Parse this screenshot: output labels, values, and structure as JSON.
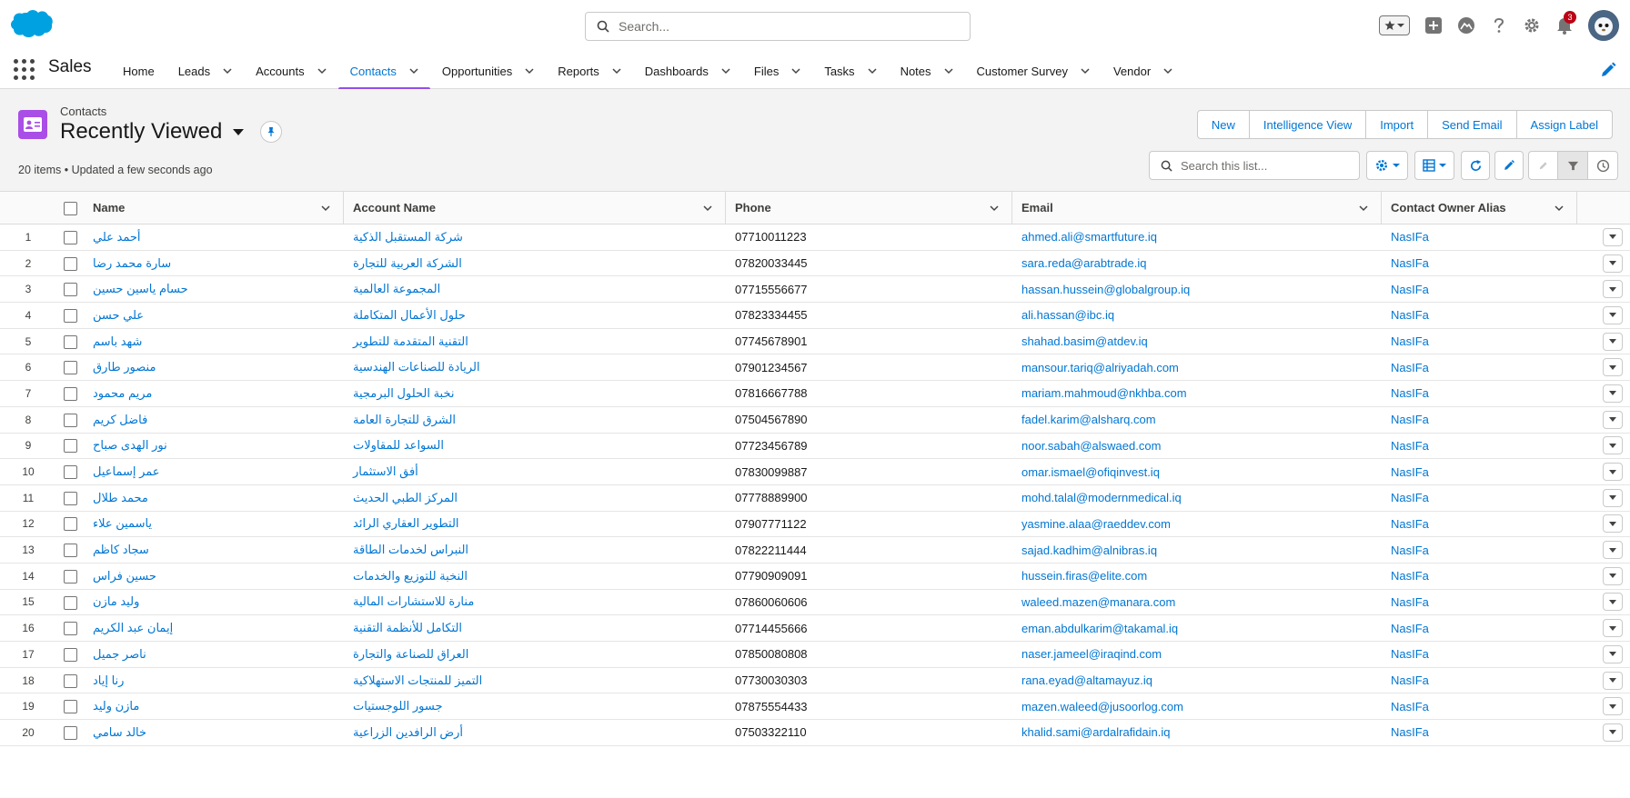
{
  "global_header": {
    "search_placeholder": "Search...",
    "notification_count": "3",
    "icons": [
      "salesforce-cloud-logo",
      "favorites-star-icon",
      "global-actions-plus-icon",
      "trailhead-icon",
      "help-icon",
      "setup-gear-icon",
      "notifications-bell-icon",
      "user-avatar"
    ]
  },
  "nav": {
    "app_name": "Sales",
    "items": [
      {
        "label": "Home",
        "has_menu": false,
        "active": false
      },
      {
        "label": "Leads",
        "has_menu": true,
        "active": false
      },
      {
        "label": "Accounts",
        "has_menu": true,
        "active": false
      },
      {
        "label": "Contacts",
        "has_menu": true,
        "active": true
      },
      {
        "label": "Opportunities",
        "has_menu": true,
        "active": false
      },
      {
        "label": "Reports",
        "has_menu": true,
        "active": false
      },
      {
        "label": "Dashboards",
        "has_menu": true,
        "active": false
      },
      {
        "label": "Files",
        "has_menu": true,
        "active": false
      },
      {
        "label": "Tasks",
        "has_menu": true,
        "active": false
      },
      {
        "label": "Notes",
        "has_menu": true,
        "active": false
      },
      {
        "label": "Customer Survey",
        "has_menu": true,
        "active": false
      },
      {
        "label": "Vendor",
        "has_menu": true,
        "active": false
      }
    ]
  },
  "list_view": {
    "object_label": "Contacts",
    "title": "Recently Viewed",
    "meta": "20 items • Updated a few seconds ago",
    "buttons": [
      "New",
      "Intelligence View",
      "Import",
      "Send Email",
      "Assign Label"
    ],
    "search_placeholder": "Search this list...",
    "accent_color": "#0176d3",
    "icon_color": "#a94ee6"
  },
  "table": {
    "columns": [
      "Name",
      "Account Name",
      "Phone",
      "Email",
      "Contact Owner Alias"
    ],
    "rows": [
      {
        "n": "1",
        "name": "أحمد علي",
        "account": "شركة المستقبل الذكية",
        "phone": "07710011223",
        "email": "ahmed.ali@smartfuture.iq",
        "owner": "NasIFa"
      },
      {
        "n": "2",
        "name": "سارة محمد رضا",
        "account": "الشركة العربية للتجارة",
        "phone": "07820033445",
        "email": "sara.reda@arabtrade.iq",
        "owner": "NasIFa"
      },
      {
        "n": "3",
        "name": "حسام ياسين حسين",
        "account": "المجموعة العالمية",
        "phone": "07715556677",
        "email": "hassan.hussein@globalgroup.iq",
        "owner": "NasIFa"
      },
      {
        "n": "4",
        "name": "علي حسن",
        "account": "حلول الأعمال المتكاملة",
        "phone": "07823334455",
        "email": "ali.hassan@ibc.iq",
        "owner": "NasIFa"
      },
      {
        "n": "5",
        "name": "شهد باسم",
        "account": "التقنية المتقدمة للتطوير",
        "phone": "07745678901",
        "email": "shahad.basim@atdev.iq",
        "owner": "NasIFa"
      },
      {
        "n": "6",
        "name": "منصور طارق",
        "account": "الريادة للصناعات الهندسية",
        "phone": "07901234567",
        "email": "mansour.tariq@alriyadah.com",
        "owner": "NasIFa"
      },
      {
        "n": "7",
        "name": "مريم محمود",
        "account": "نخبة الحلول البرمجية",
        "phone": "07816667788",
        "email": "mariam.mahmoud@nkhba.com",
        "owner": "NasIFa"
      },
      {
        "n": "8",
        "name": "فاضل كريم",
        "account": "الشرق للتجارة العامة",
        "phone": "07504567890",
        "email": "fadel.karim@alsharq.com",
        "owner": "NasIFa"
      },
      {
        "n": "9",
        "name": "نور الهدى صباح",
        "account": "السواعد للمقاولات",
        "phone": "07723456789",
        "email": "noor.sabah@alswaed.com",
        "owner": "NasIFa"
      },
      {
        "n": "10",
        "name": "عمر إسماعيل",
        "account": "أفق الاستثمار",
        "phone": "07830099887",
        "email": "omar.ismael@ofiqinvest.iq",
        "owner": "NasIFa"
      },
      {
        "n": "11",
        "name": "محمد طلال",
        "account": "المركز الطبي الحديث",
        "phone": "07778889900",
        "email": "mohd.talal@modernmedical.iq",
        "owner": "NasIFa"
      },
      {
        "n": "12",
        "name": "ياسمين علاء",
        "account": "التطوير العقاري الرائد",
        "phone": "07907771122",
        "email": "yasmine.alaa@raeddev.com",
        "owner": "NasIFa"
      },
      {
        "n": "13",
        "name": "سجاد كاظم",
        "account": "النبراس لخدمات الطاقة",
        "phone": "07822211444",
        "email": "sajad.kadhim@alnibras.iq",
        "owner": "NasIFa"
      },
      {
        "n": "14",
        "name": "حسين فراس",
        "account": "النخبة للتوزيع والخدمات",
        "phone": "07790909091",
        "email": "hussein.firas@elite.com",
        "owner": "NasIFa"
      },
      {
        "n": "15",
        "name": "وليد مازن",
        "account": "منارة للاستشارات المالية",
        "phone": "07860060606",
        "email": "waleed.mazen@manara.com",
        "owner": "NasIFa"
      },
      {
        "n": "16",
        "name": "إيمان عبد الكريم",
        "account": "التكامل للأنظمة التقنية",
        "phone": "07714455666",
        "email": "eman.abdulkarim@takamal.iq",
        "owner": "NasIFa"
      },
      {
        "n": "17",
        "name": "ناصر جميل",
        "account": "العراق للصناعة والتجارة",
        "phone": "07850080808",
        "email": "naser.jameel@iraqind.com",
        "owner": "NasIFa"
      },
      {
        "n": "18",
        "name": "رنا إياد",
        "account": "التميز للمنتجات الاستهلاكية",
        "phone": "07730030303",
        "email": "rana.eyad@altamayuz.iq",
        "owner": "NasIFa"
      },
      {
        "n": "19",
        "name": "مازن وليد",
        "account": "جسور اللوجستيات",
        "phone": "07875554433",
        "email": "mazen.waleed@jusoorlog.com",
        "owner": "NasIFa"
      },
      {
        "n": "20",
        "name": "خالد سامي",
        "account": "أرض الرافدين الزراعية",
        "phone": "07503322110",
        "email": "khalid.sami@ardalrafidain.iq",
        "owner": "NasIFa"
      }
    ]
  }
}
